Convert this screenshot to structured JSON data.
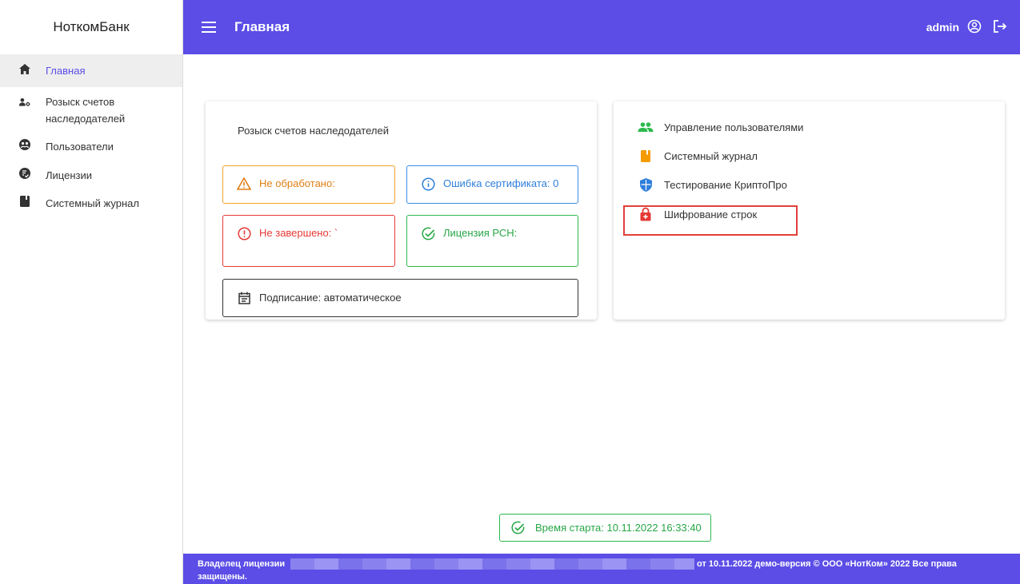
{
  "sidebar": {
    "brand": "НоткомБанк",
    "items": [
      {
        "label": "Главная",
        "icon": "home-icon",
        "active": true
      },
      {
        "label": "Розыск счетов наследодателей",
        "icon": "user-settings-icon"
      },
      {
        "label": "Пользователи",
        "icon": "users-circle-icon"
      },
      {
        "label": "Лицензии",
        "icon": "license-icon"
      },
      {
        "label": "Системный журнал",
        "icon": "book-icon"
      }
    ]
  },
  "header": {
    "title": "Главная",
    "user": "admin"
  },
  "search_card": {
    "title": "Розыск счетов наследодателей",
    "not_processed": "Не обработано:",
    "cert_error": "Ошибка сертификата: 0",
    "not_finished": "Не завершено: `",
    "license_rsn": "Лицензия РСН:",
    "signing": "Подписание: автоматическое"
  },
  "links_card": {
    "items": [
      {
        "label": "Управление пользователями",
        "icon": "users-icon"
      },
      {
        "label": "Системный журнал",
        "icon": "journal-icon"
      },
      {
        "label": "Тестирование КриптоПро",
        "icon": "shield-icon"
      },
      {
        "label": "Шифрование строк",
        "icon": "lock-icon"
      }
    ]
  },
  "start_time": "Время старта: 10.11.2022 16:33:40",
  "footer": {
    "owner_label": "Владелец лицензии",
    "owner_cont": "защищены.",
    "rights": "от 10.11.2022 демо-версия © ООО «НотКом» 2022 Все права"
  },
  "colors": {
    "primary": "#5b4de6",
    "orange": "#f0a22c",
    "blue": "#3b8de8",
    "red": "#e53935",
    "green": "#2cb94e"
  }
}
